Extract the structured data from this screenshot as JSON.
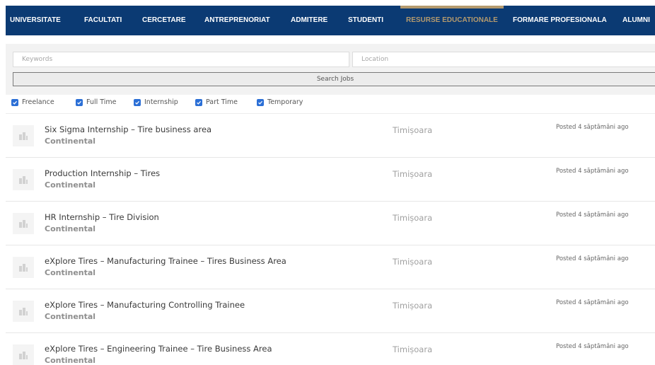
{
  "nav": {
    "items": [
      {
        "label": "UNIVERSITATE",
        "active": false
      },
      {
        "label": "FACULTATI",
        "active": false
      },
      {
        "label": "CERCETARE",
        "active": false
      },
      {
        "label": "ANTREPRENORIAT",
        "active": false
      },
      {
        "label": "ADMITERE",
        "active": false
      },
      {
        "label": "STUDENTI",
        "active": false
      },
      {
        "label": "RESURSE EDUCATIONALE",
        "active": true
      },
      {
        "label": "FORMARE PROFESIONALA",
        "active": false
      },
      {
        "label": "ALUMNI",
        "active": false
      }
    ],
    "background": "#0b3a73",
    "active_color": "#b49a6e"
  },
  "search": {
    "keywords_placeholder": "Keywords",
    "location_placeholder": "Location",
    "button_label": "Search Jobs"
  },
  "filters": [
    {
      "label": "Freelance",
      "checked": true
    },
    {
      "label": "Full Time",
      "checked": true
    },
    {
      "label": "Internship",
      "checked": true
    },
    {
      "label": "Part Time",
      "checked": true
    },
    {
      "label": "Temporary",
      "checked": true
    }
  ],
  "jobs": [
    {
      "title": "Six Sigma Internship – Tire business area",
      "company": "Continental",
      "location": "Timișoara",
      "posted": "Posted 4 săptămâni ago"
    },
    {
      "title": "Production Internship – Tires",
      "company": "Continental",
      "location": "Timișoara",
      "posted": "Posted 4 săptămâni ago"
    },
    {
      "title": "HR Internship – Tire Division",
      "company": "Continental",
      "location": "Timișoara",
      "posted": "Posted 4 săptămâni ago"
    },
    {
      "title": "eXplore Tires – Manufacturing Trainee – Tires Business Area",
      "company": "Continental",
      "location": "Timișoara",
      "posted": "Posted 4 săptămâni ago"
    },
    {
      "title": "eXplore Tires – Manufacturing Controlling Trainee",
      "company": "Continental",
      "location": "Timișoara",
      "posted": "Posted 4 săptămâni ago"
    },
    {
      "title": "eXplore Tires – Engineering Trainee – Tire Business Area",
      "company": "Continental",
      "location": "Timișoara",
      "posted": "Posted 4 săptămâni ago"
    }
  ],
  "icons": {
    "company_logo": "building-icon",
    "checkbox": "checkmark-icon"
  }
}
